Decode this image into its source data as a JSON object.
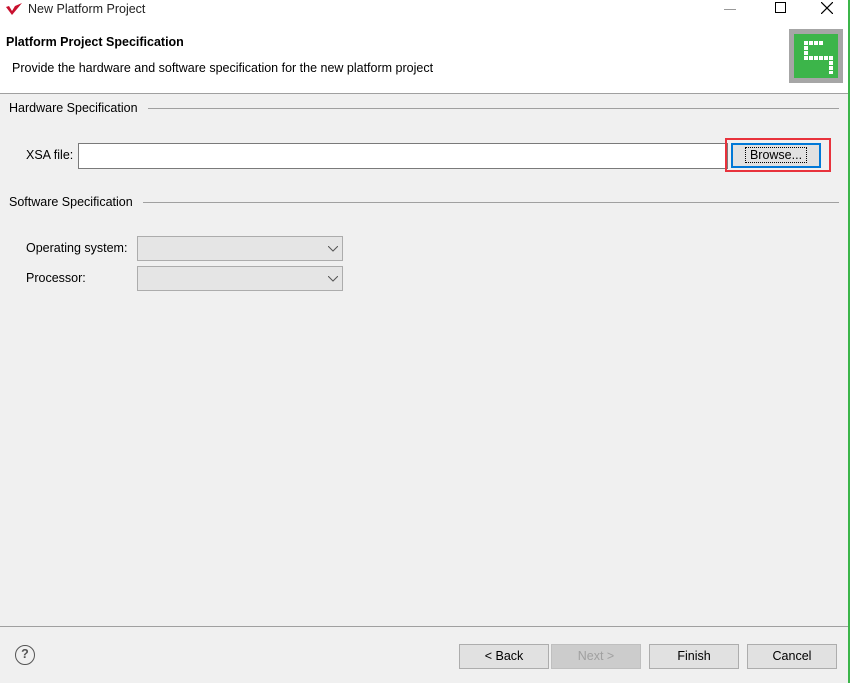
{
  "window": {
    "title": "New Platform Project",
    "controls": {
      "minimize": "minimize-icon",
      "maximize": "maximize-icon",
      "close": "close-icon"
    }
  },
  "header": {
    "title": "Platform Project Specification",
    "description": "Provide the hardware and software specification for the new platform project"
  },
  "hardware": {
    "group_label": "Hardware Specification",
    "xsa_label": "XSA file:",
    "xsa_value": "",
    "browse_label": "Browse...",
    "highlight_color": "#e8323c"
  },
  "software": {
    "group_label": "Software Specification",
    "os_label": "Operating system:",
    "os_value": "",
    "processor_label": "Processor:",
    "processor_value": ""
  },
  "footer": {
    "back": "< Back",
    "next": "Next >",
    "finish": "Finish",
    "cancel": "Cancel"
  },
  "colors": {
    "accent_green": "#3cb54a",
    "button_focus": "#0078d7"
  }
}
